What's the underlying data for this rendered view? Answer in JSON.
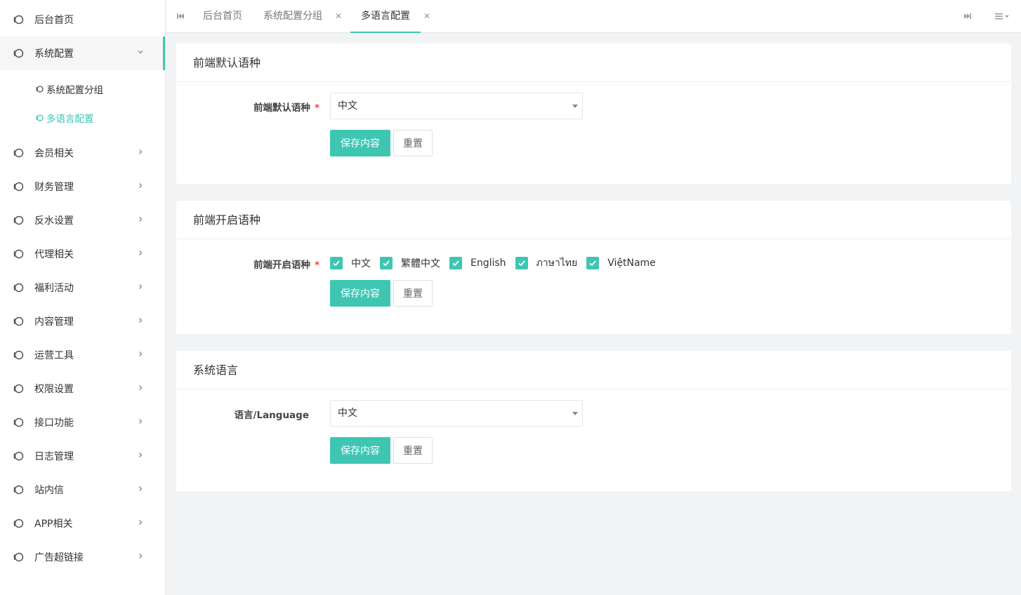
{
  "colors": {
    "accent": "#3ec6b3",
    "required": "#ff3b3b"
  },
  "sidebar": {
    "items": [
      {
        "label": "后台首页",
        "icon": "circle-icon"
      },
      {
        "label": "系统配置",
        "icon": "circle-icon",
        "expanded": true
      },
      {
        "label": "会员相关",
        "icon": "circle-icon"
      },
      {
        "label": "财务管理",
        "icon": "circle-icon"
      },
      {
        "label": "反水设置",
        "icon": "circle-icon"
      },
      {
        "label": "代理相关",
        "icon": "circle-icon"
      },
      {
        "label": "福利活动",
        "icon": "circle-icon"
      },
      {
        "label": "内容管理",
        "icon": "circle-icon"
      },
      {
        "label": "运营工具",
        "icon": "circle-icon"
      },
      {
        "label": "权限设置",
        "icon": "circle-icon"
      },
      {
        "label": "接口功能",
        "icon": "circle-icon"
      },
      {
        "label": "日志管理",
        "icon": "circle-icon"
      },
      {
        "label": "站内信",
        "icon": "circle-icon"
      },
      {
        "label": "APP相关",
        "icon": "circle-icon"
      },
      {
        "label": "广告超链接",
        "icon": "circle-icon"
      }
    ],
    "sub_items": [
      {
        "label": "系统配置分组"
      },
      {
        "label": "多语言配置",
        "active": true
      }
    ]
  },
  "tabs": [
    {
      "label": "后台首页"
    },
    {
      "label": "系统配置分组",
      "closable": true
    },
    {
      "label": "多语言配置",
      "closable": true,
      "active": true
    }
  ],
  "cards": {
    "default_lang": {
      "title": "前端默认语种",
      "label": "前端默认语种",
      "selected": "中文",
      "save": "保存内容",
      "reset": "重置"
    },
    "enabled_lang": {
      "title": "前端开启语种",
      "label": "前端开启语种",
      "options": [
        {
          "label": "中文",
          "checked": true
        },
        {
          "label": "繁體中文",
          "checked": true
        },
        {
          "label": "English",
          "checked": true
        },
        {
          "label": "ภาษาไทย",
          "checked": true
        },
        {
          "label": "ViệtName",
          "checked": true
        }
      ],
      "save": "保存内容",
      "reset": "重置"
    },
    "system_lang": {
      "title": "系统语言",
      "label": "语言/Language",
      "selected": "中文",
      "save": "保存内容",
      "reset": "重置"
    }
  }
}
